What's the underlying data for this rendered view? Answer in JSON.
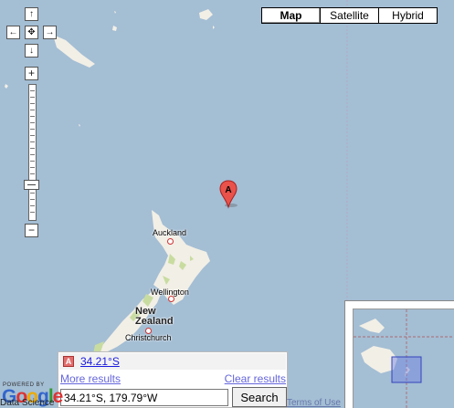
{
  "map_types": [
    "Map",
    "Satellite",
    "Hybrid"
  ],
  "active_map_type": "Map",
  "zoom_level_fraction": 0.73,
  "pan_arrows": {
    "up": "↑",
    "left": "←",
    "center": "✥",
    "right": "→",
    "down": "↓"
  },
  "zoom_in": "+",
  "zoom_out": "−",
  "cities": {
    "auckland": "Auckland",
    "wellington": "Wellington",
    "christchurch": "Christchurch"
  },
  "country_label_line1": "New",
  "country_label_line2": "Zealand",
  "marker_letter": "A",
  "search": {
    "result_badge": "A",
    "result_link": "34.21°S",
    "more_results": "More results",
    "clear_results": "Clear results",
    "query": "34.21°S, 179.79°W",
    "button_label": "Search"
  },
  "branding": {
    "powered_by": "POWERED BY",
    "logo": "Google",
    "data_credit": "Data Science",
    "terms": "Terms of Use"
  },
  "colors": {
    "water": "#a4bed4",
    "land": "#f2efe6",
    "park": "#c8dca0",
    "marker": "#e8524a"
  }
}
